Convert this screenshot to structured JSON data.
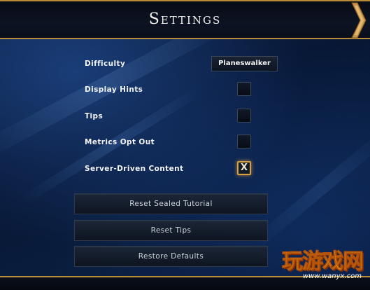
{
  "header": {
    "title": "Settings"
  },
  "settings": {
    "difficulty": {
      "label": "Difficulty",
      "value": "Planeswalker"
    },
    "display_hints": {
      "label": "Display Hints",
      "checked": false
    },
    "tips": {
      "label": "Tips",
      "checked": false
    },
    "metrics_opt_out": {
      "label": "Metrics Opt Out",
      "checked": false
    },
    "server_driven_content": {
      "label": "Server-Driven Content",
      "checked": true,
      "mark": "X"
    }
  },
  "buttons": {
    "reset_sealed_tutorial": "Reset Sealed Tutorial",
    "reset_tips": "Reset Tips",
    "restore_defaults": "Restore Defaults"
  },
  "watermark": {
    "logo_text": "玩游戏网",
    "url": "www.wanyx.com"
  },
  "colors": {
    "accent_gold": "#b88d3a",
    "checkbox_glow": "#d9a23f",
    "background": "#0b1f44"
  }
}
